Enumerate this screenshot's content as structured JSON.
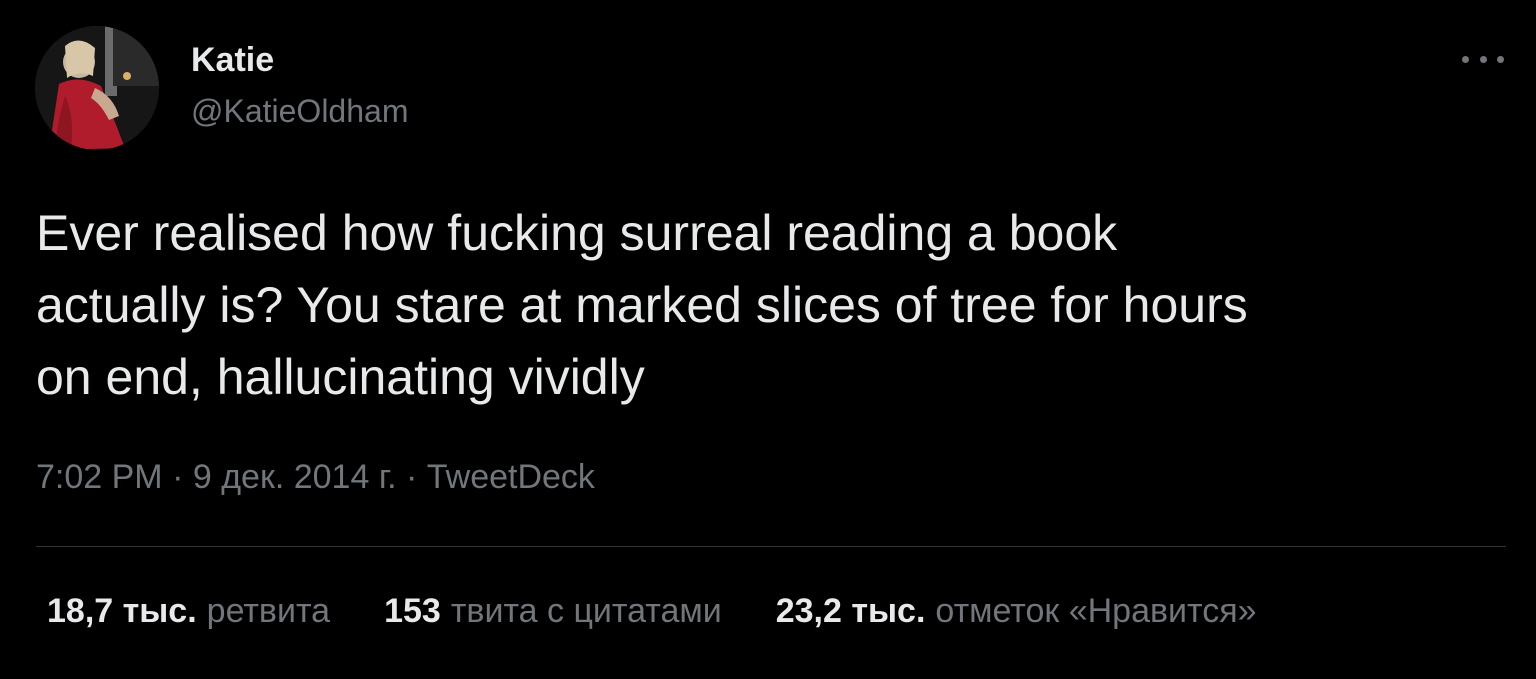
{
  "user": {
    "display_name": "Katie",
    "handle": "@KatieOldham"
  },
  "tweet": {
    "lines": [
      "Ever realised how fucking surreal reading a book",
      "actually is? You stare at marked slices of tree for hours",
      "on end, hallucinating vividly"
    ],
    "time": "7:02 PM",
    "separator": "·",
    "date": "9 дек. 2014 г.",
    "source": "TweetDeck"
  },
  "stats": [
    {
      "value": "18,7 тыс.",
      "label": "ретвита"
    },
    {
      "value": "153",
      "label": "твита с цитатами"
    },
    {
      "value": "23,2 тыс.",
      "label": "отметок «Нравится»"
    }
  ],
  "icons": {
    "more": "more-horizontal-icon"
  },
  "colors": {
    "background": "#000000",
    "primary_text": "#e7e9ea",
    "secondary_text": "#71767b",
    "divider": "#2f3336"
  }
}
